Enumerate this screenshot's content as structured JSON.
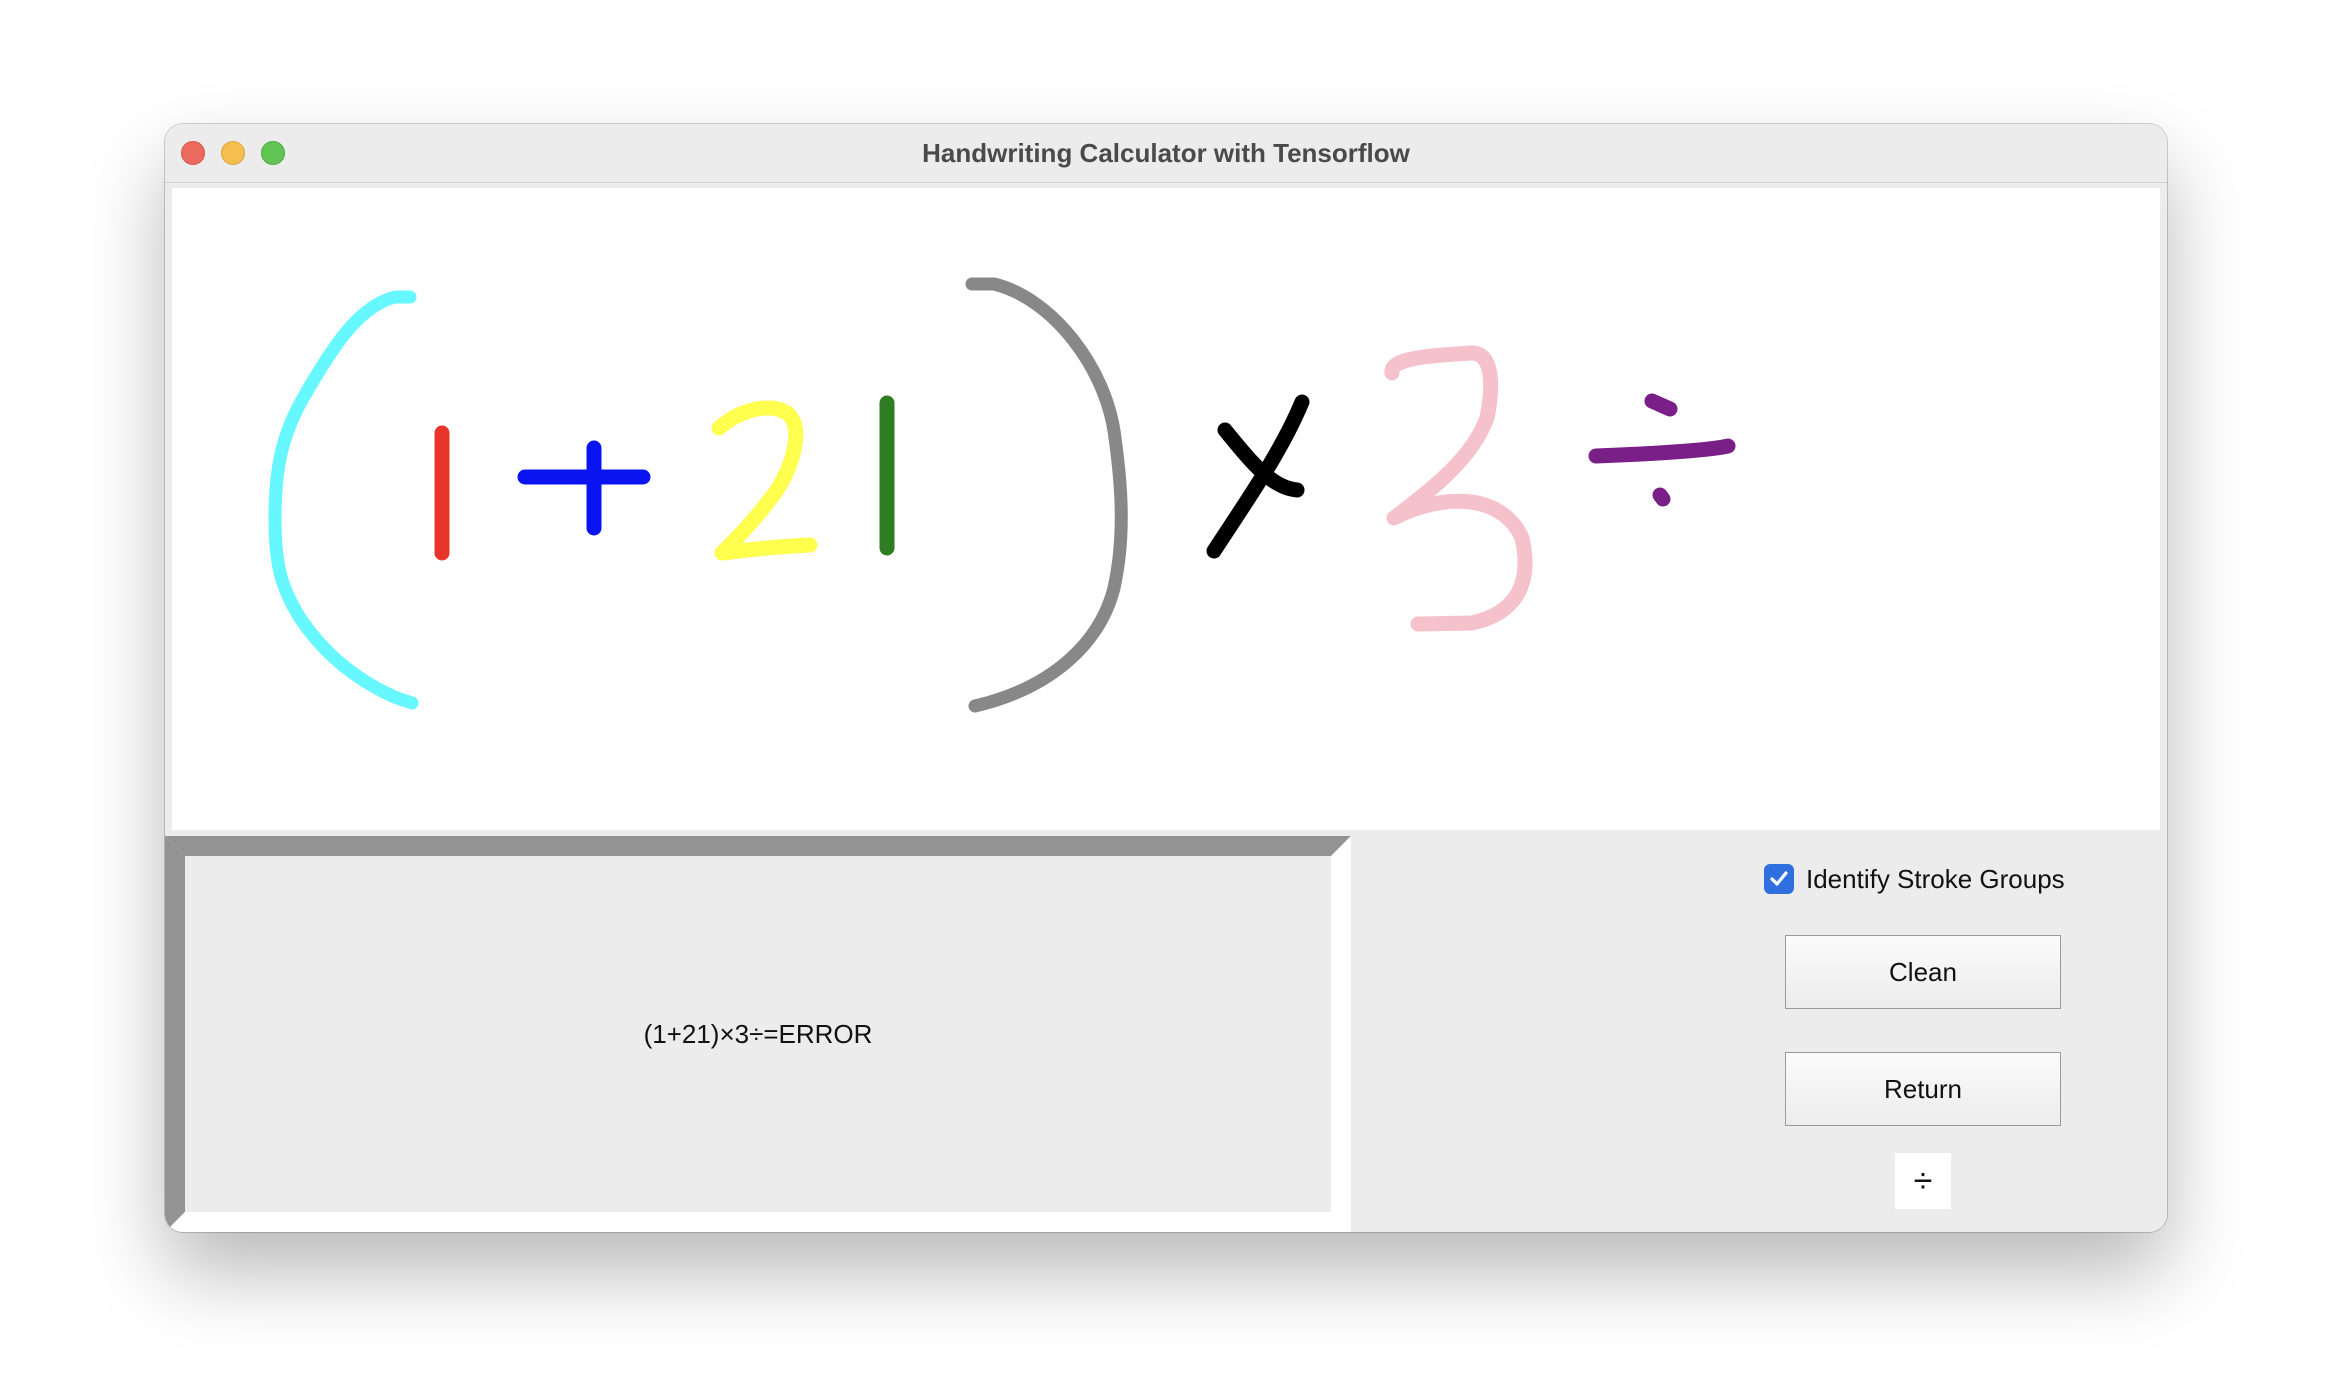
{
  "window": {
    "title": "Handwriting Calculator with Tensorflow"
  },
  "canvas": {
    "stroke_colors": {
      "open_paren": "#66f7ff",
      "one_first": "#e8342a",
      "plus": "#0a14f0",
      "two": "#ffff4d",
      "one_second": "#2e7d22",
      "close_paren": "#888888",
      "times": "#000000",
      "three": "#f5c2cc",
      "divide": "#7a1e88"
    }
  },
  "result": {
    "expression": "(1+21)×3÷=ERROR"
  },
  "controls": {
    "identify_stroke_groups_label": "Identify Stroke Groups",
    "identify_stroke_groups_checked": true,
    "clean_label": "Clean",
    "return_label": "Return",
    "current_symbol": "÷"
  },
  "colors": {
    "checkbox_accent": "#2f6fe0",
    "panel_background": "#ececec",
    "bevel_dark": "#939393"
  }
}
